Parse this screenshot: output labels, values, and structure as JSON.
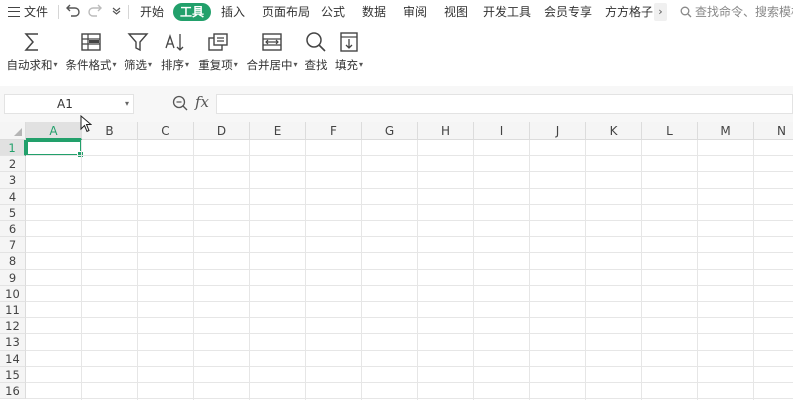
{
  "menubar": {
    "file_label": "文件",
    "tabs": [
      {
        "label": "开始"
      },
      {
        "label": "工具"
      },
      {
        "label": "插入"
      },
      {
        "label": "页面布局"
      },
      {
        "label": "公式"
      },
      {
        "label": "数据"
      },
      {
        "label": "审阅"
      },
      {
        "label": "视图"
      },
      {
        "label": "开发工具"
      },
      {
        "label": "会员专享"
      },
      {
        "label": "方方格子"
      }
    ],
    "active_tab": "工具",
    "more_glyph": "›",
    "search_placeholder": "查找命令、搜索模板"
  },
  "ribbon": {
    "buttons": [
      {
        "label": "自动求和",
        "icon": "sigma-icon",
        "has_dropdown": true
      },
      {
        "label": "条件格式",
        "icon": "conditional-format-icon",
        "has_dropdown": true
      },
      {
        "label": "筛选",
        "icon": "filter-icon",
        "has_dropdown": true
      },
      {
        "label": "排序",
        "icon": "sort-icon",
        "has_dropdown": true
      },
      {
        "label": "重复项",
        "icon": "duplicates-icon",
        "has_dropdown": true
      },
      {
        "label": "合并居中",
        "icon": "merge-center-icon",
        "has_dropdown": true
      },
      {
        "label": "查找",
        "icon": "magnifier-icon",
        "has_dropdown": false
      },
      {
        "label": "填充",
        "icon": "fill-down-icon",
        "has_dropdown": true
      }
    ]
  },
  "formula_bar": {
    "name_box": "A1",
    "fx_label": "fx",
    "formula_value": ""
  },
  "sheet": {
    "columns": [
      "A",
      "B",
      "C",
      "D",
      "E",
      "F",
      "G",
      "H",
      "I",
      "J",
      "K",
      "L",
      "M",
      "N"
    ],
    "rows": [
      "1",
      "2",
      "3",
      "4",
      "5",
      "6",
      "7",
      "8",
      "9",
      "10",
      "11",
      "12",
      "13",
      "14",
      "15",
      "16"
    ],
    "selected_cell": "A1",
    "accent_color": "#22a06b"
  }
}
